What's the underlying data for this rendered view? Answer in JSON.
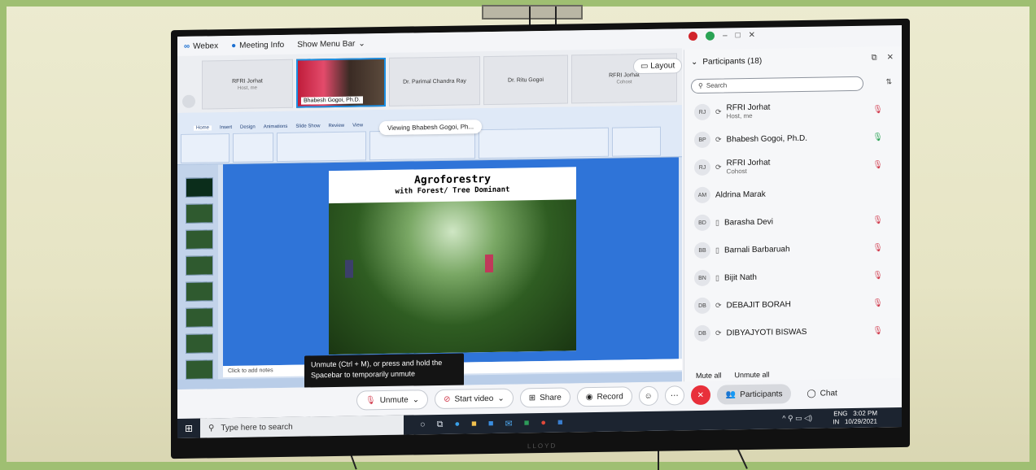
{
  "topbar": {
    "app": "Webex",
    "meeting_info": "Meeting Info",
    "menu_bar": "Show Menu Bar"
  },
  "thumbnails": [
    {
      "name": "RFRI Jorhat",
      "role": "Host, me"
    },
    {
      "name": "Bhabesh Gogoi, Ph.D."
    },
    {
      "name": "Dr. Parimal Chandra Ray"
    },
    {
      "name": "Dr. Ritu Gogoi"
    },
    {
      "name": "RFRI Jorhat",
      "role": "Cohost"
    }
  ],
  "layout_label": "Layout",
  "viewing": "Viewing Bhabesh Gogoi, Ph...",
  "ribbon_tabs": [
    "Home",
    "Insert",
    "Design",
    "Animations",
    "Slide Show",
    "Review",
    "View"
  ],
  "slide": {
    "title": "Agroforestry",
    "subtitle": "with Forest/ Tree Dominant"
  },
  "notes_placeholder": "Click to add notes",
  "tooltip": "Unmute (Ctrl + M), or press and hold the Spacebar to temporarily unmute",
  "controls": {
    "unmute": "Unmute",
    "start_video": "Start video",
    "share": "Share",
    "record": "Record",
    "participants": "Participants",
    "chat": "Chat"
  },
  "panel": {
    "title": "Participants (18)",
    "search_placeholder": "Search",
    "participants": [
      {
        "initials": "RJ",
        "name": "RFRI Jorhat",
        "role": "Host, me"
      },
      {
        "initials": "BP",
        "name": "Bhabesh Gogoi, Ph.D."
      },
      {
        "initials": "RJ",
        "name": "RFRI Jorhat",
        "role": "Cohost"
      },
      {
        "initials": "AM",
        "name": "Aldrina Marak"
      },
      {
        "initials": "BD",
        "name": "Barasha Devi"
      },
      {
        "initials": "BB",
        "name": "Barnali Barbaruah"
      },
      {
        "initials": "BN",
        "name": "Bijit Nath"
      },
      {
        "initials": "DB",
        "name": "DEBAJIT BORAH"
      },
      {
        "initials": "DB",
        "name": "DIBYAJYOTI BISWAS"
      }
    ],
    "mute_all": "Mute all",
    "unmute_all": "Unmute all"
  },
  "taskbar": {
    "search_placeholder": "Type here to search",
    "lang": "ENG",
    "region": "IN",
    "time": "3:02 PM",
    "date": "10/29/2021"
  }
}
